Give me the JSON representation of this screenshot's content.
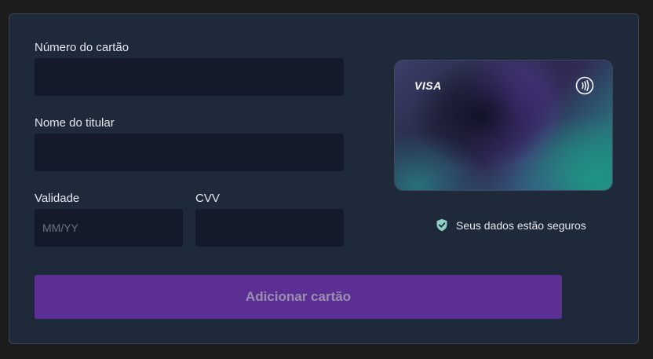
{
  "form": {
    "card_number_label": "Número do cartão",
    "card_number_value": "",
    "holder_name_label": "Nome do titular",
    "holder_name_value": "",
    "expiry_label": "Validade",
    "expiry_placeholder": "MM/YY",
    "expiry_value": "",
    "cvv_label": "CVV",
    "cvv_value": "",
    "submit_label": "Adicionar cartão"
  },
  "card_preview": {
    "brand": "VISA",
    "contactless_icon": "contactless-icon"
  },
  "security": {
    "icon": "shield-check-icon",
    "text": "Seus dados estão seguros"
  },
  "colors": {
    "accent": "#5b2f93",
    "panel": "#1e2939",
    "input_bg": "#131a29",
    "shield": "#8fd0c4"
  }
}
